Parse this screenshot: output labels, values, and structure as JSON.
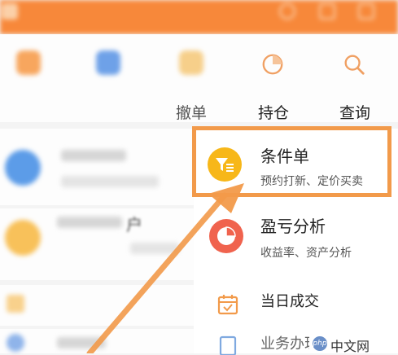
{
  "header": {
    "title": "",
    "subtitle": ""
  },
  "nav": {
    "items": [
      {
        "label": ""
      },
      {
        "label": ""
      },
      {
        "label": "撤单"
      },
      {
        "label": "持仓"
      },
      {
        "label": "查询"
      }
    ]
  },
  "list": {
    "row2_label": "户"
  },
  "popup": {
    "items": [
      {
        "title": "条件单",
        "subtitle": "预约打新、定价买卖",
        "icon": "funnel-list-icon"
      },
      {
        "title": "盈亏分析",
        "subtitle": "收益率、资产分析",
        "icon": "pie-chart-icon"
      },
      {
        "title": "当日成交",
        "icon": "calendar-check-icon"
      },
      {
        "title": "业务办理",
        "icon": "document-icon"
      }
    ]
  },
  "watermark": {
    "logo": "php",
    "text": "中文网"
  },
  "colors": {
    "brand": "#f7883a",
    "highlight": "#f29a4a",
    "condition_icon": "#f7b719",
    "profit_icon": "#f0634e",
    "calendar_icon": "#f29a4a"
  }
}
